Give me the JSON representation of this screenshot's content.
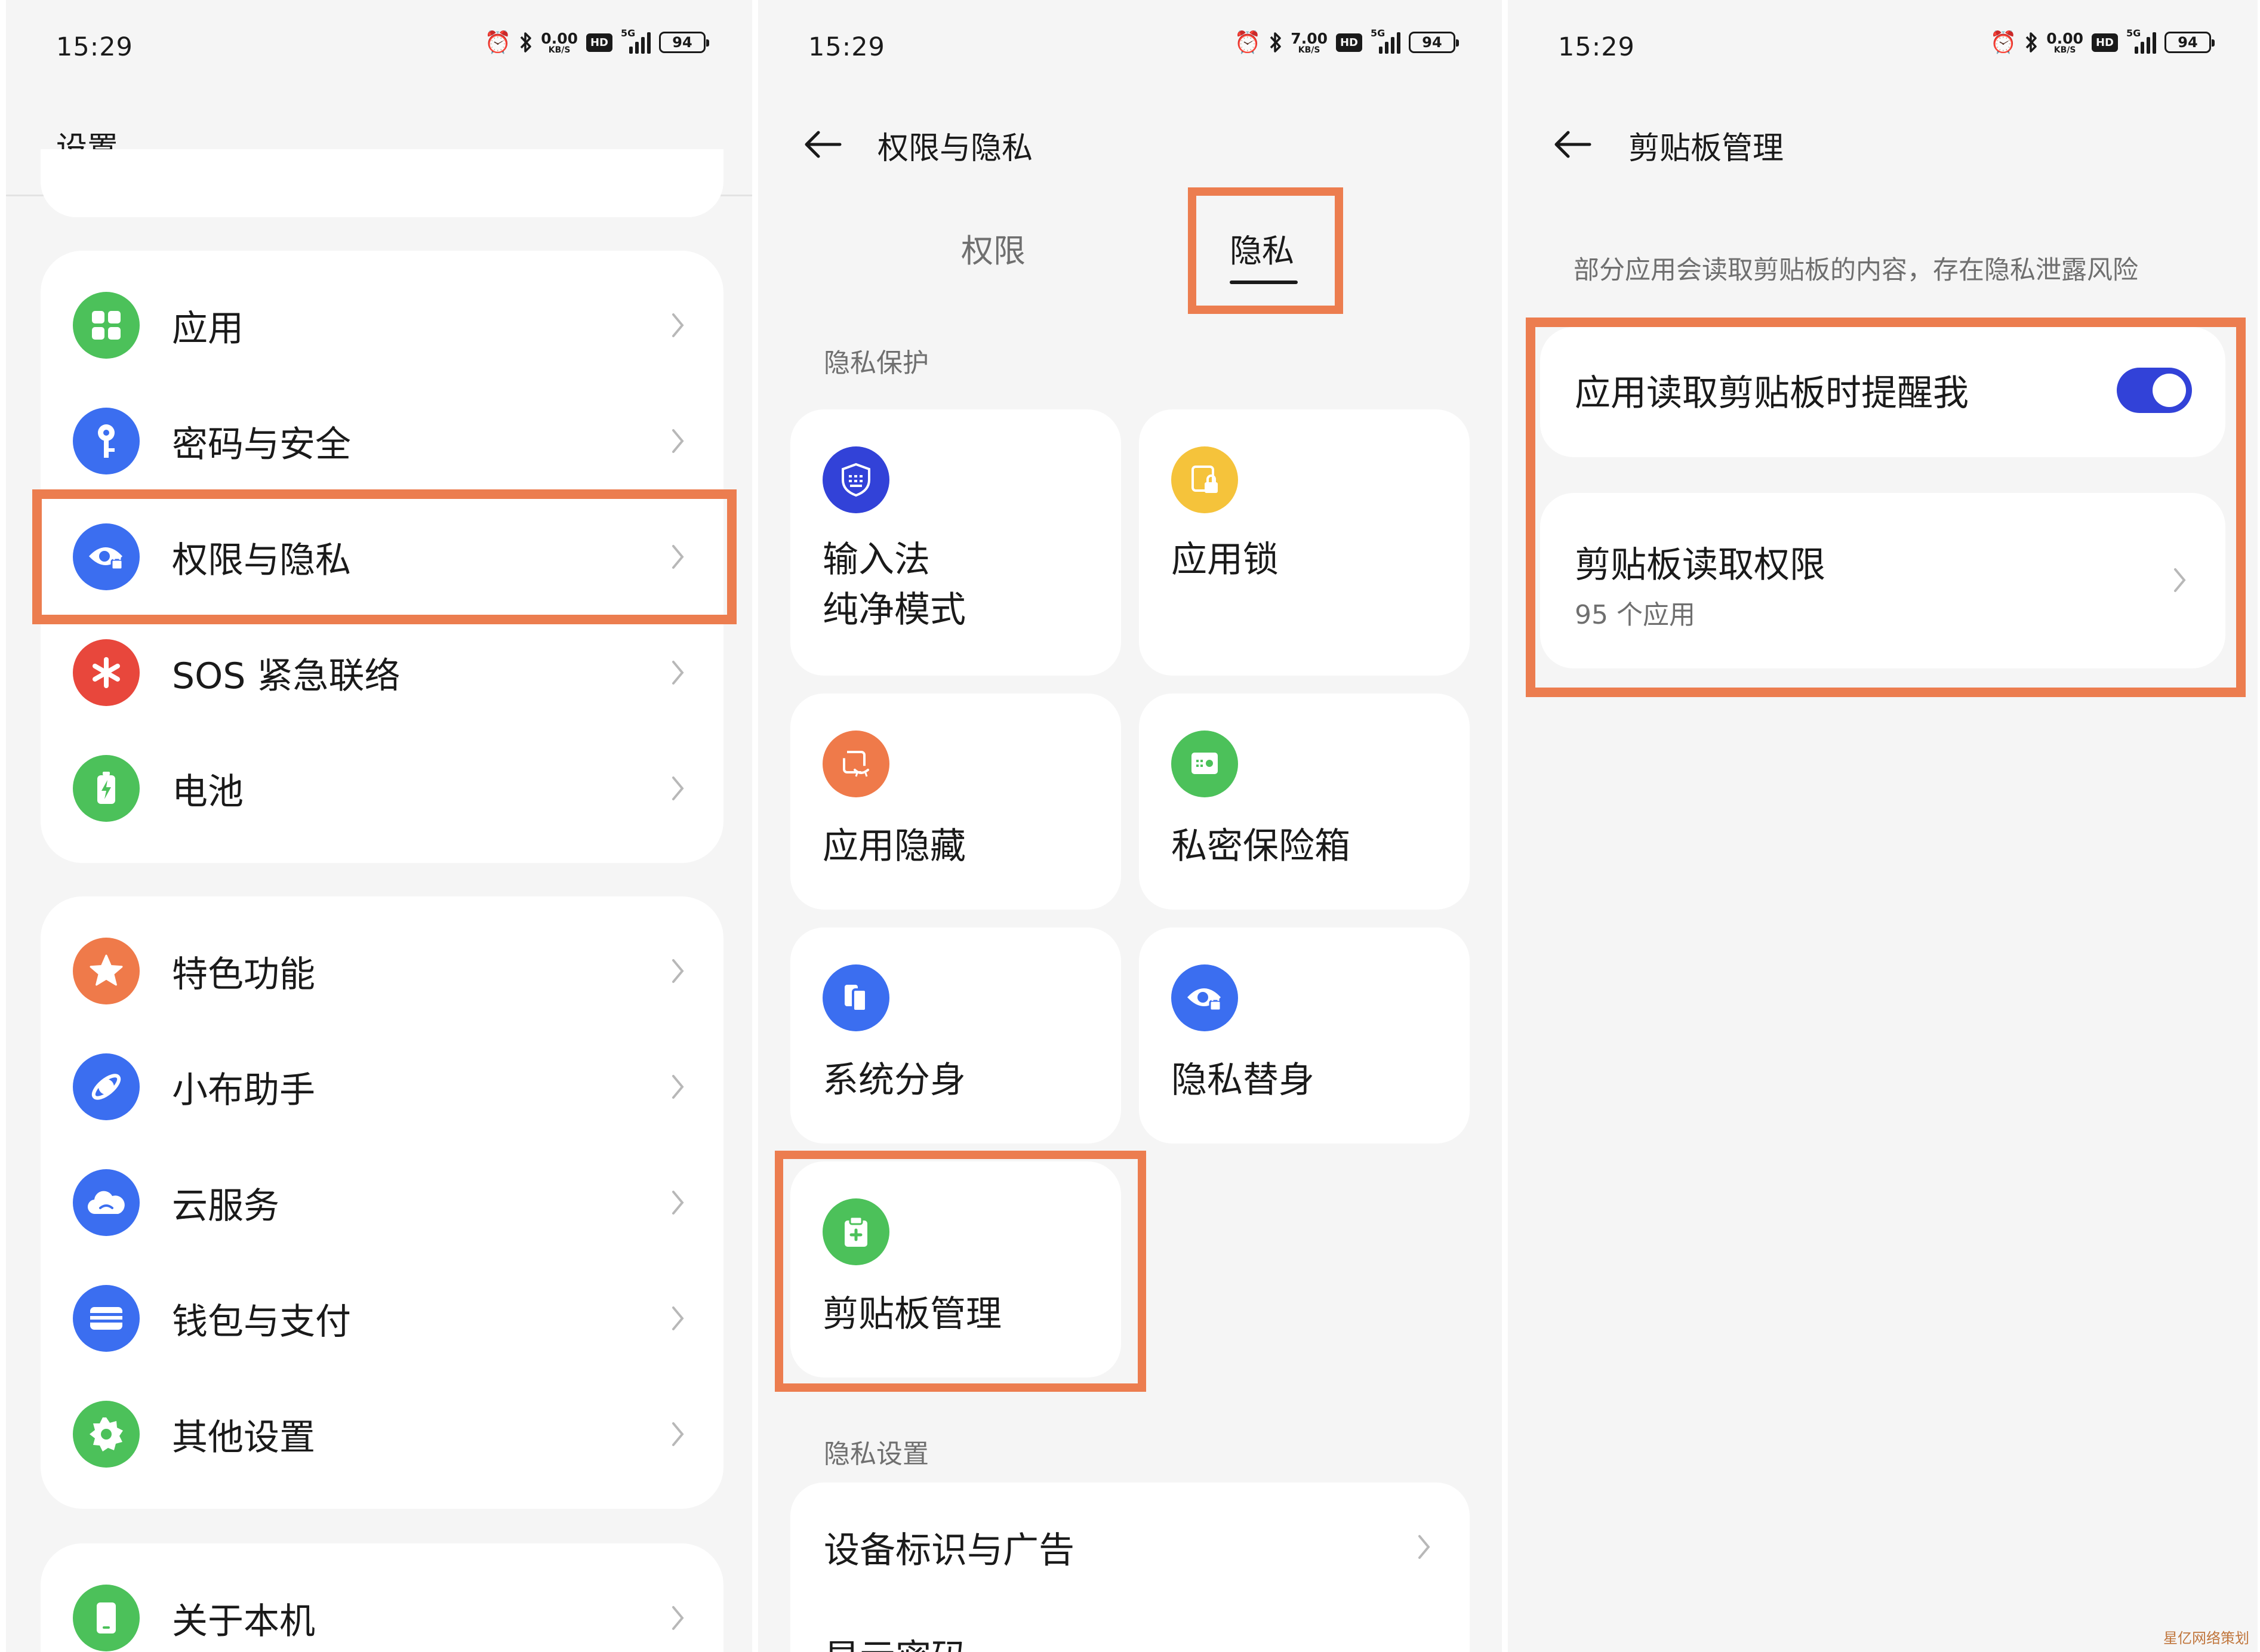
{
  "status_bars": [
    {
      "time": "15:29",
      "speed_value": "0.00",
      "speed_unit": "KB/S",
      "hd": "HD",
      "network": "5G",
      "battery": "94"
    },
    {
      "time": "15:29",
      "speed_value": "7.00",
      "speed_unit": "KB/S",
      "hd": "HD",
      "network": "5G",
      "battery": "94"
    },
    {
      "time": "15:29",
      "speed_value": "0.00",
      "speed_unit": "KB/S",
      "hd": "HD",
      "network": "5G",
      "battery": "94"
    }
  ],
  "settings": {
    "title": "设置",
    "groups": [
      {
        "items": [
          {
            "label": "应用",
            "icon": "apps-icon",
            "color": "#4cc15a"
          },
          {
            "label": "密码与安全",
            "icon": "key-icon",
            "color": "#3b6ef0"
          },
          {
            "label": "权限与隐私",
            "icon": "privacy-eye-icon",
            "color": "#3b6ef0"
          },
          {
            "label": "SOS 紧急联络",
            "icon": "sos-asterisk-icon",
            "color": "#e8473c"
          },
          {
            "label": "电池",
            "icon": "battery-icon",
            "color": "#4cc15a"
          }
        ]
      },
      {
        "items": [
          {
            "label": "特色功能",
            "icon": "star-icon",
            "color": "#ef7a4a"
          },
          {
            "label": "小布助手",
            "icon": "assistant-icon",
            "color": "#3b6ef0"
          },
          {
            "label": "云服务",
            "icon": "cloud-icon",
            "color": "#3b6ef0"
          },
          {
            "label": "钱包与支付",
            "icon": "wallet-icon",
            "color": "#3b6ef0"
          },
          {
            "label": "其他设置",
            "icon": "gear-icon",
            "color": "#4cc15a"
          }
        ]
      },
      {
        "items": [
          {
            "label": "关于本机",
            "icon": "phone-icon",
            "color": "#4cc15a"
          }
        ]
      }
    ]
  },
  "privacy": {
    "title": "权限与隐私",
    "tabs": [
      {
        "label": "权限"
      },
      {
        "label": "隐私"
      }
    ],
    "section_protection": "隐私保护",
    "tiles": [
      {
        "label": "输入法\n纯净模式",
        "icon": "keyboard-shield-icon",
        "color": "#3242d8"
      },
      {
        "label": "应用锁",
        "icon": "app-lock-icon",
        "color": "#f5c33b"
      },
      {
        "label": "应用隐藏",
        "icon": "app-hide-icon",
        "color": "#ef7a4a"
      },
      {
        "label": "私密保险箱",
        "icon": "safe-icon",
        "color": "#4cc15a"
      },
      {
        "label": "系统分身",
        "icon": "clone-icon",
        "color": "#3b6ef0"
      },
      {
        "label": "隐私替身",
        "icon": "privacy-eye-icon",
        "color": "#3b6ef0"
      },
      {
        "label": "剪贴板管理",
        "icon": "clipboard-icon",
        "color": "#4cc15a"
      }
    ],
    "section_settings": "隐私设置",
    "list_items": [
      {
        "label": "设备标识与广告"
      },
      {
        "label": "显示密码"
      }
    ]
  },
  "clipboard": {
    "title": "剪贴板管理",
    "description": "部分应用会读取剪贴板的内容，存在隐私泄露风险",
    "toggle_item": {
      "label": "应用读取剪贴板时提醒我",
      "on": true
    },
    "permission_item": {
      "label": "剪贴板读取权限",
      "sub": "95 个应用"
    }
  },
  "colors": {
    "highlight": "#ec7d4f",
    "toggle_on": "#3242d8"
  },
  "watermark": "星亿网络策划"
}
